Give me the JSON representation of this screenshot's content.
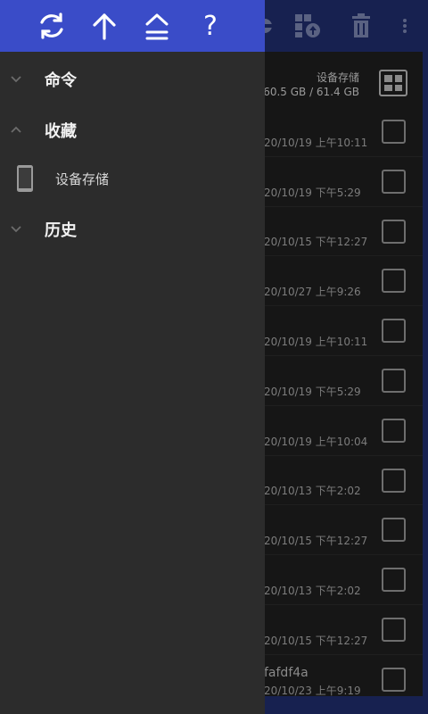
{
  "colors": {
    "drawer_toolbar": "#3a4cc8",
    "drawer_bg": "#2c2c2c",
    "appbar_dim": "#172150",
    "list_bg": "#161616"
  },
  "drawer": {
    "toolbar_icons": [
      "refresh-icon",
      "arrow-up-icon",
      "double-chevron-up-icon",
      "help-icon"
    ],
    "help_label": "?",
    "sections": {
      "commands": {
        "label": "命令",
        "expanded": false
      },
      "favorites": {
        "label": "收藏",
        "expanded": true
      },
      "history": {
        "label": "历史",
        "expanded": false
      }
    },
    "favorites_items": [
      {
        "label": "设备存储",
        "icon": "phone-icon"
      }
    ]
  },
  "background": {
    "toolbar_icons": [
      "gift-icon",
      "upload-grid-icon",
      "trash-icon",
      "more-vert-icon"
    ],
    "storage": {
      "name": "设备存储",
      "size": "60.5 GB / 61.4 GB"
    },
    "files": [
      {
        "name": "",
        "date": "20/10/19 上午10:11"
      },
      {
        "name": "",
        "date": "20/10/19 下午5:29"
      },
      {
        "name": "",
        "date": "20/10/15 下午12:27"
      },
      {
        "name": "",
        "date": "20/10/27 上午9:26"
      },
      {
        "name": "",
        "date": "20/10/19 上午10:11"
      },
      {
        "name": "",
        "date": "20/10/19 下午5:29"
      },
      {
        "name": "",
        "date": "20/10/19 上午10:04"
      },
      {
        "name": "",
        "date": "20/10/13 下午2:02"
      },
      {
        "name": "",
        "date": "20/10/15 下午12:27"
      },
      {
        "name": "",
        "date": "20/10/13 下午2:02"
      },
      {
        "name": "",
        "date": "20/10/15 下午12:27"
      },
      {
        "name": "fafdf4a",
        "date": "20/10/23 上午9:19"
      }
    ]
  }
}
